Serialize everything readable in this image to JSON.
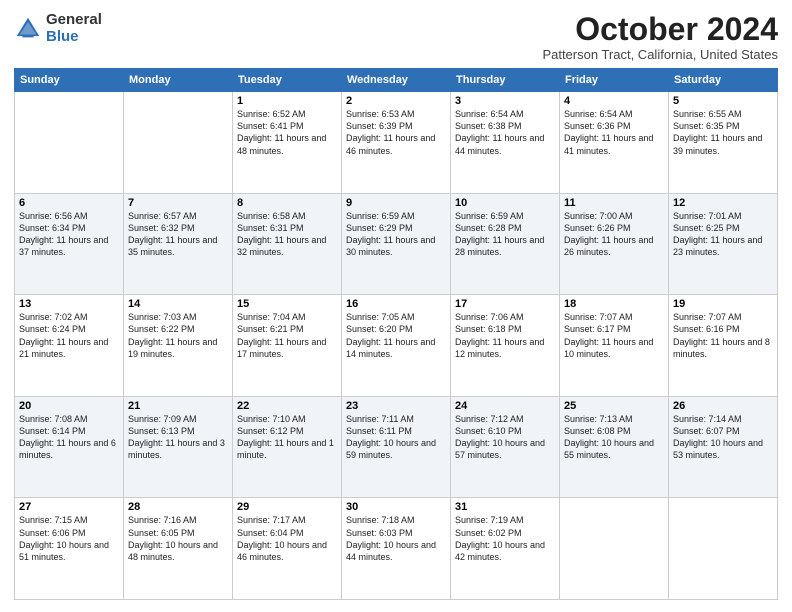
{
  "logo": {
    "general": "General",
    "blue": "Blue"
  },
  "title": "October 2024",
  "location": "Patterson Tract, California, United States",
  "days_header": [
    "Sunday",
    "Monday",
    "Tuesday",
    "Wednesday",
    "Thursday",
    "Friday",
    "Saturday"
  ],
  "weeks": [
    [
      {
        "day": "",
        "info": ""
      },
      {
        "day": "",
        "info": ""
      },
      {
        "day": "1",
        "info": "Sunrise: 6:52 AM\nSunset: 6:41 PM\nDaylight: 11 hours and 48 minutes."
      },
      {
        "day": "2",
        "info": "Sunrise: 6:53 AM\nSunset: 6:39 PM\nDaylight: 11 hours and 46 minutes."
      },
      {
        "day": "3",
        "info": "Sunrise: 6:54 AM\nSunset: 6:38 PM\nDaylight: 11 hours and 44 minutes."
      },
      {
        "day": "4",
        "info": "Sunrise: 6:54 AM\nSunset: 6:36 PM\nDaylight: 11 hours and 41 minutes."
      },
      {
        "day": "5",
        "info": "Sunrise: 6:55 AM\nSunset: 6:35 PM\nDaylight: 11 hours and 39 minutes."
      }
    ],
    [
      {
        "day": "6",
        "info": "Sunrise: 6:56 AM\nSunset: 6:34 PM\nDaylight: 11 hours and 37 minutes."
      },
      {
        "day": "7",
        "info": "Sunrise: 6:57 AM\nSunset: 6:32 PM\nDaylight: 11 hours and 35 minutes."
      },
      {
        "day": "8",
        "info": "Sunrise: 6:58 AM\nSunset: 6:31 PM\nDaylight: 11 hours and 32 minutes."
      },
      {
        "day": "9",
        "info": "Sunrise: 6:59 AM\nSunset: 6:29 PM\nDaylight: 11 hours and 30 minutes."
      },
      {
        "day": "10",
        "info": "Sunrise: 6:59 AM\nSunset: 6:28 PM\nDaylight: 11 hours and 28 minutes."
      },
      {
        "day": "11",
        "info": "Sunrise: 7:00 AM\nSunset: 6:26 PM\nDaylight: 11 hours and 26 minutes."
      },
      {
        "day": "12",
        "info": "Sunrise: 7:01 AM\nSunset: 6:25 PM\nDaylight: 11 hours and 23 minutes."
      }
    ],
    [
      {
        "day": "13",
        "info": "Sunrise: 7:02 AM\nSunset: 6:24 PM\nDaylight: 11 hours and 21 minutes."
      },
      {
        "day": "14",
        "info": "Sunrise: 7:03 AM\nSunset: 6:22 PM\nDaylight: 11 hours and 19 minutes."
      },
      {
        "day": "15",
        "info": "Sunrise: 7:04 AM\nSunset: 6:21 PM\nDaylight: 11 hours and 17 minutes."
      },
      {
        "day": "16",
        "info": "Sunrise: 7:05 AM\nSunset: 6:20 PM\nDaylight: 11 hours and 14 minutes."
      },
      {
        "day": "17",
        "info": "Sunrise: 7:06 AM\nSunset: 6:18 PM\nDaylight: 11 hours and 12 minutes."
      },
      {
        "day": "18",
        "info": "Sunrise: 7:07 AM\nSunset: 6:17 PM\nDaylight: 11 hours and 10 minutes."
      },
      {
        "day": "19",
        "info": "Sunrise: 7:07 AM\nSunset: 6:16 PM\nDaylight: 11 hours and 8 minutes."
      }
    ],
    [
      {
        "day": "20",
        "info": "Sunrise: 7:08 AM\nSunset: 6:14 PM\nDaylight: 11 hours and 6 minutes."
      },
      {
        "day": "21",
        "info": "Sunrise: 7:09 AM\nSunset: 6:13 PM\nDaylight: 11 hours and 3 minutes."
      },
      {
        "day": "22",
        "info": "Sunrise: 7:10 AM\nSunset: 6:12 PM\nDaylight: 11 hours and 1 minute."
      },
      {
        "day": "23",
        "info": "Sunrise: 7:11 AM\nSunset: 6:11 PM\nDaylight: 10 hours and 59 minutes."
      },
      {
        "day": "24",
        "info": "Sunrise: 7:12 AM\nSunset: 6:10 PM\nDaylight: 10 hours and 57 minutes."
      },
      {
        "day": "25",
        "info": "Sunrise: 7:13 AM\nSunset: 6:08 PM\nDaylight: 10 hours and 55 minutes."
      },
      {
        "day": "26",
        "info": "Sunrise: 7:14 AM\nSunset: 6:07 PM\nDaylight: 10 hours and 53 minutes."
      }
    ],
    [
      {
        "day": "27",
        "info": "Sunrise: 7:15 AM\nSunset: 6:06 PM\nDaylight: 10 hours and 51 minutes."
      },
      {
        "day": "28",
        "info": "Sunrise: 7:16 AM\nSunset: 6:05 PM\nDaylight: 10 hours and 48 minutes."
      },
      {
        "day": "29",
        "info": "Sunrise: 7:17 AM\nSunset: 6:04 PM\nDaylight: 10 hours and 46 minutes."
      },
      {
        "day": "30",
        "info": "Sunrise: 7:18 AM\nSunset: 6:03 PM\nDaylight: 10 hours and 44 minutes."
      },
      {
        "day": "31",
        "info": "Sunrise: 7:19 AM\nSunset: 6:02 PM\nDaylight: 10 hours and 42 minutes."
      },
      {
        "day": "",
        "info": ""
      },
      {
        "day": "",
        "info": ""
      }
    ]
  ]
}
